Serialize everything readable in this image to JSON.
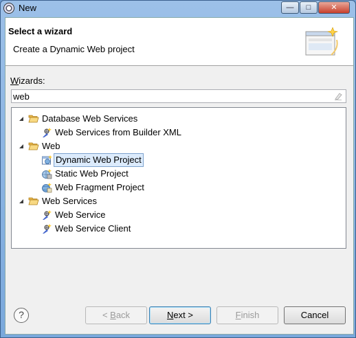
{
  "window": {
    "title": "New"
  },
  "title_buttons": {
    "minimize": "—",
    "maximize": "□",
    "close": "✕"
  },
  "header": {
    "title": "Select a wizard",
    "description": "Create a Dynamic Web project"
  },
  "wizards": {
    "label_prefix": "W",
    "label_rest": "izards:",
    "filter_value": "web"
  },
  "tree": {
    "items": [
      {
        "label": "Database Web Services",
        "icon": "folder-open-icon"
      },
      {
        "label": "Web Services from Builder XML",
        "icon": "web-service-wizard-icon"
      },
      {
        "label": "Web",
        "icon": "folder-open-icon"
      },
      {
        "label": "Dynamic Web Project",
        "icon": "dynamic-web-project-icon",
        "selected": true
      },
      {
        "label": "Static Web Project",
        "icon": "static-web-project-icon"
      },
      {
        "label": "Web Fragment Project",
        "icon": "web-fragment-project-icon"
      },
      {
        "label": "Web Services",
        "icon": "folder-open-icon"
      },
      {
        "label": "Web Service",
        "icon": "web-service-wizard-icon"
      },
      {
        "label": "Web Service Client",
        "icon": "web-service-wizard-icon"
      }
    ]
  },
  "buttons": {
    "help": "?",
    "back_prefix": "< ",
    "back_mnemonic": "B",
    "back_rest": "ack",
    "next_mnemonic": "N",
    "next_rest": "ext >",
    "finish_mnemonic": "F",
    "finish_rest": "inish",
    "cancel": "Cancel"
  }
}
